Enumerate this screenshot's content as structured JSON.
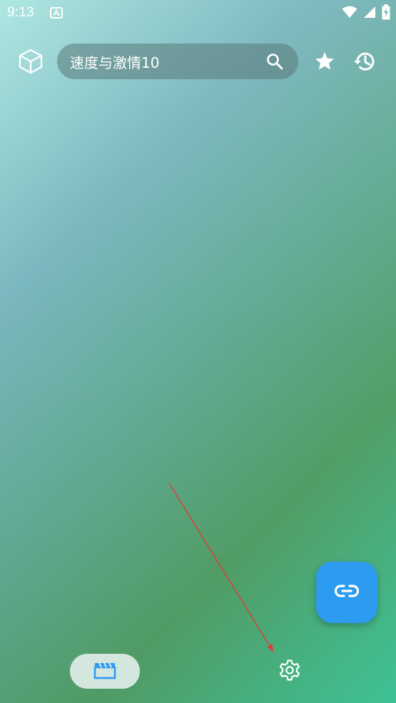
{
  "status_bar": {
    "time": "9:13",
    "app_icon": "android-auto-icon",
    "right_icons": [
      "wifi-icon",
      "cellular-signal-icon",
      "battery-charging-icon"
    ]
  },
  "top_bar": {
    "logo_icon": "cube-icon",
    "search": {
      "value": "速度与激情10",
      "icon": "search-icon"
    },
    "actions": [
      "star-icon",
      "history-icon"
    ]
  },
  "fab": {
    "icon": "link-icon",
    "color": "#2d9bf0"
  },
  "bottom_nav": {
    "items": [
      {
        "icon": "movie-clapperboard-icon",
        "selected": true
      },
      {
        "icon": "gear-icon",
        "selected": false
      }
    ]
  },
  "colors": {
    "accent": "#2d9bf0",
    "icon_on_dark": "#ffffff",
    "selected_pill": "#e1f0eb",
    "annotation": "#e53935"
  }
}
